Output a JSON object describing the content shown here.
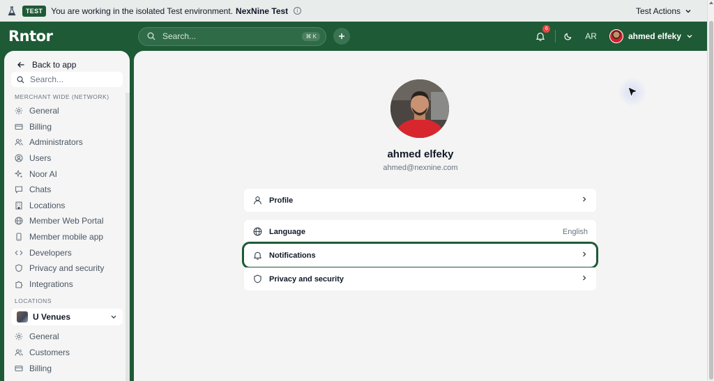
{
  "banner": {
    "badge": "TEST",
    "message": "You are working in the isolated Test environment.",
    "env_name": "NexNine Test",
    "info_glyph": "i",
    "actions_label": "Test Actions"
  },
  "topbar": {
    "logo": "Rntor",
    "search_placeholder": "Search...",
    "search_shortcut": "⌘ K",
    "notification_count": "6",
    "language_toggle": "AR",
    "user_name": "ahmed elfeky"
  },
  "sidebar": {
    "back_label": "Back to app",
    "search_placeholder": "Search...",
    "section_network": "MERCHANT WIDE (NETWORK)",
    "network_items": [
      {
        "label": "General",
        "icon": "gear-icon"
      },
      {
        "label": "Billing",
        "icon": "credit-card-icon"
      },
      {
        "label": "Administrators",
        "icon": "users-icon"
      },
      {
        "label": "Users",
        "icon": "user-circle-icon"
      },
      {
        "label": "Noor AI",
        "icon": "sparkles-icon"
      },
      {
        "label": "Chats",
        "icon": "chat-icon"
      },
      {
        "label": "Locations",
        "icon": "building-icon"
      },
      {
        "label": "Member Web Portal",
        "icon": "globe-icon"
      },
      {
        "label": "Member mobile app",
        "icon": "phone-icon"
      },
      {
        "label": "Developers",
        "icon": "code-icon"
      },
      {
        "label": "Privacy and security",
        "icon": "shield-icon"
      },
      {
        "label": "Integrations",
        "icon": "puzzle-icon"
      }
    ],
    "section_locations": "LOCATIONS",
    "venue_selected": "U Venues",
    "location_items": [
      {
        "label": "General",
        "icon": "gear-icon"
      },
      {
        "label": "Customers",
        "icon": "users-icon"
      },
      {
        "label": "Billing",
        "icon": "credit-card-icon"
      }
    ]
  },
  "profile": {
    "name": "ahmed elfeky",
    "email": "ahmed@nexnine.com",
    "menu": [
      {
        "label": "Profile",
        "icon": "user-icon",
        "value": ""
      },
      {
        "label": "Language",
        "icon": "globe-icon",
        "value": "English"
      },
      {
        "label": "Notifications",
        "icon": "bell-icon",
        "value": ""
      },
      {
        "label": "Privacy and security",
        "icon": "shield-icon",
        "value": ""
      }
    ]
  },
  "colors": {
    "brand_green": "#1e5a36",
    "notification_red": "#ef4444"
  }
}
